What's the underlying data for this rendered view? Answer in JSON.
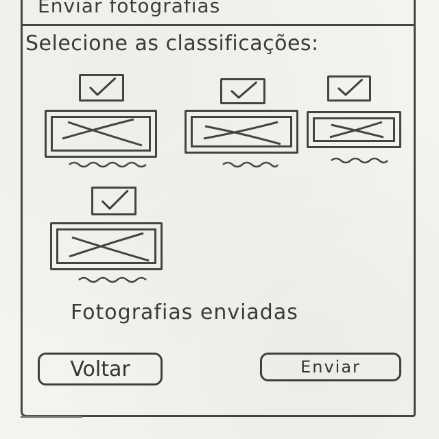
{
  "window": {
    "title": "Enviar fotografias"
  },
  "instruction": "Selecione as classificações:",
  "photos": [
    {
      "checked": true
    },
    {
      "checked": true
    },
    {
      "checked": true
    },
    {
      "checked": true
    }
  ],
  "status": "Fotografias enviadas",
  "buttons": {
    "back_label": "Voltar",
    "send_label": "Enviar"
  },
  "icons": {
    "checkbox": "checkmark-icon",
    "image_placeholder": "image-placeholder-icon"
  },
  "colors": {
    "paper": "#f4f3ee",
    "ink": "#444444"
  }
}
